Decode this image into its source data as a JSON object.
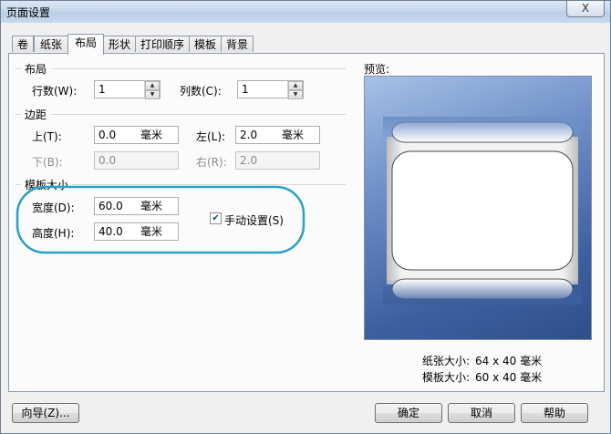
{
  "window": {
    "title": "页面设置",
    "close_label": "X"
  },
  "tabs": [
    {
      "label": "卷"
    },
    {
      "label": "纸张"
    },
    {
      "label": "布局",
      "active": true
    },
    {
      "label": "形状"
    },
    {
      "label": "打印顺序"
    },
    {
      "label": "模板"
    },
    {
      "label": "背景"
    }
  ],
  "layout": {
    "section_label": "布局",
    "rows_label": "行数(W):",
    "rows_value": "1",
    "cols_label": "列数(C):",
    "cols_value": "1"
  },
  "margins": {
    "section_label": "边距",
    "top_label": "上(T):",
    "top_value": "0.0",
    "top_unit": "毫米",
    "left_label": "左(L):",
    "left_value": "2.0",
    "left_unit": "毫米",
    "bottom_label": "下(B):",
    "bottom_value": "0.0",
    "right_label": "右(R):",
    "right_value": "2.0"
  },
  "template_size": {
    "section_label": "模板大小",
    "width_label": "宽度(D):",
    "width_value": "60.0",
    "width_unit": "毫米",
    "height_label": "高度(H):",
    "height_value": "40.0",
    "height_unit": "毫米",
    "manual_label": "手动设置(S)",
    "manual_checked": true,
    "highlight_color": "#2aa0c4"
  },
  "preview": {
    "label": "预览:",
    "paper_size_label": "纸张大小:",
    "paper_size_value": "64 x 40 毫米",
    "template_size_label": "模板大小:",
    "template_size_value": "60 x 40 毫米"
  },
  "buttons": {
    "wizard": "向导(Z)...",
    "ok": "确定",
    "cancel": "取消",
    "help": "帮助"
  },
  "spin_up_glyph": "▲",
  "spin_down_glyph": "▼",
  "check_glyph": "✔"
}
